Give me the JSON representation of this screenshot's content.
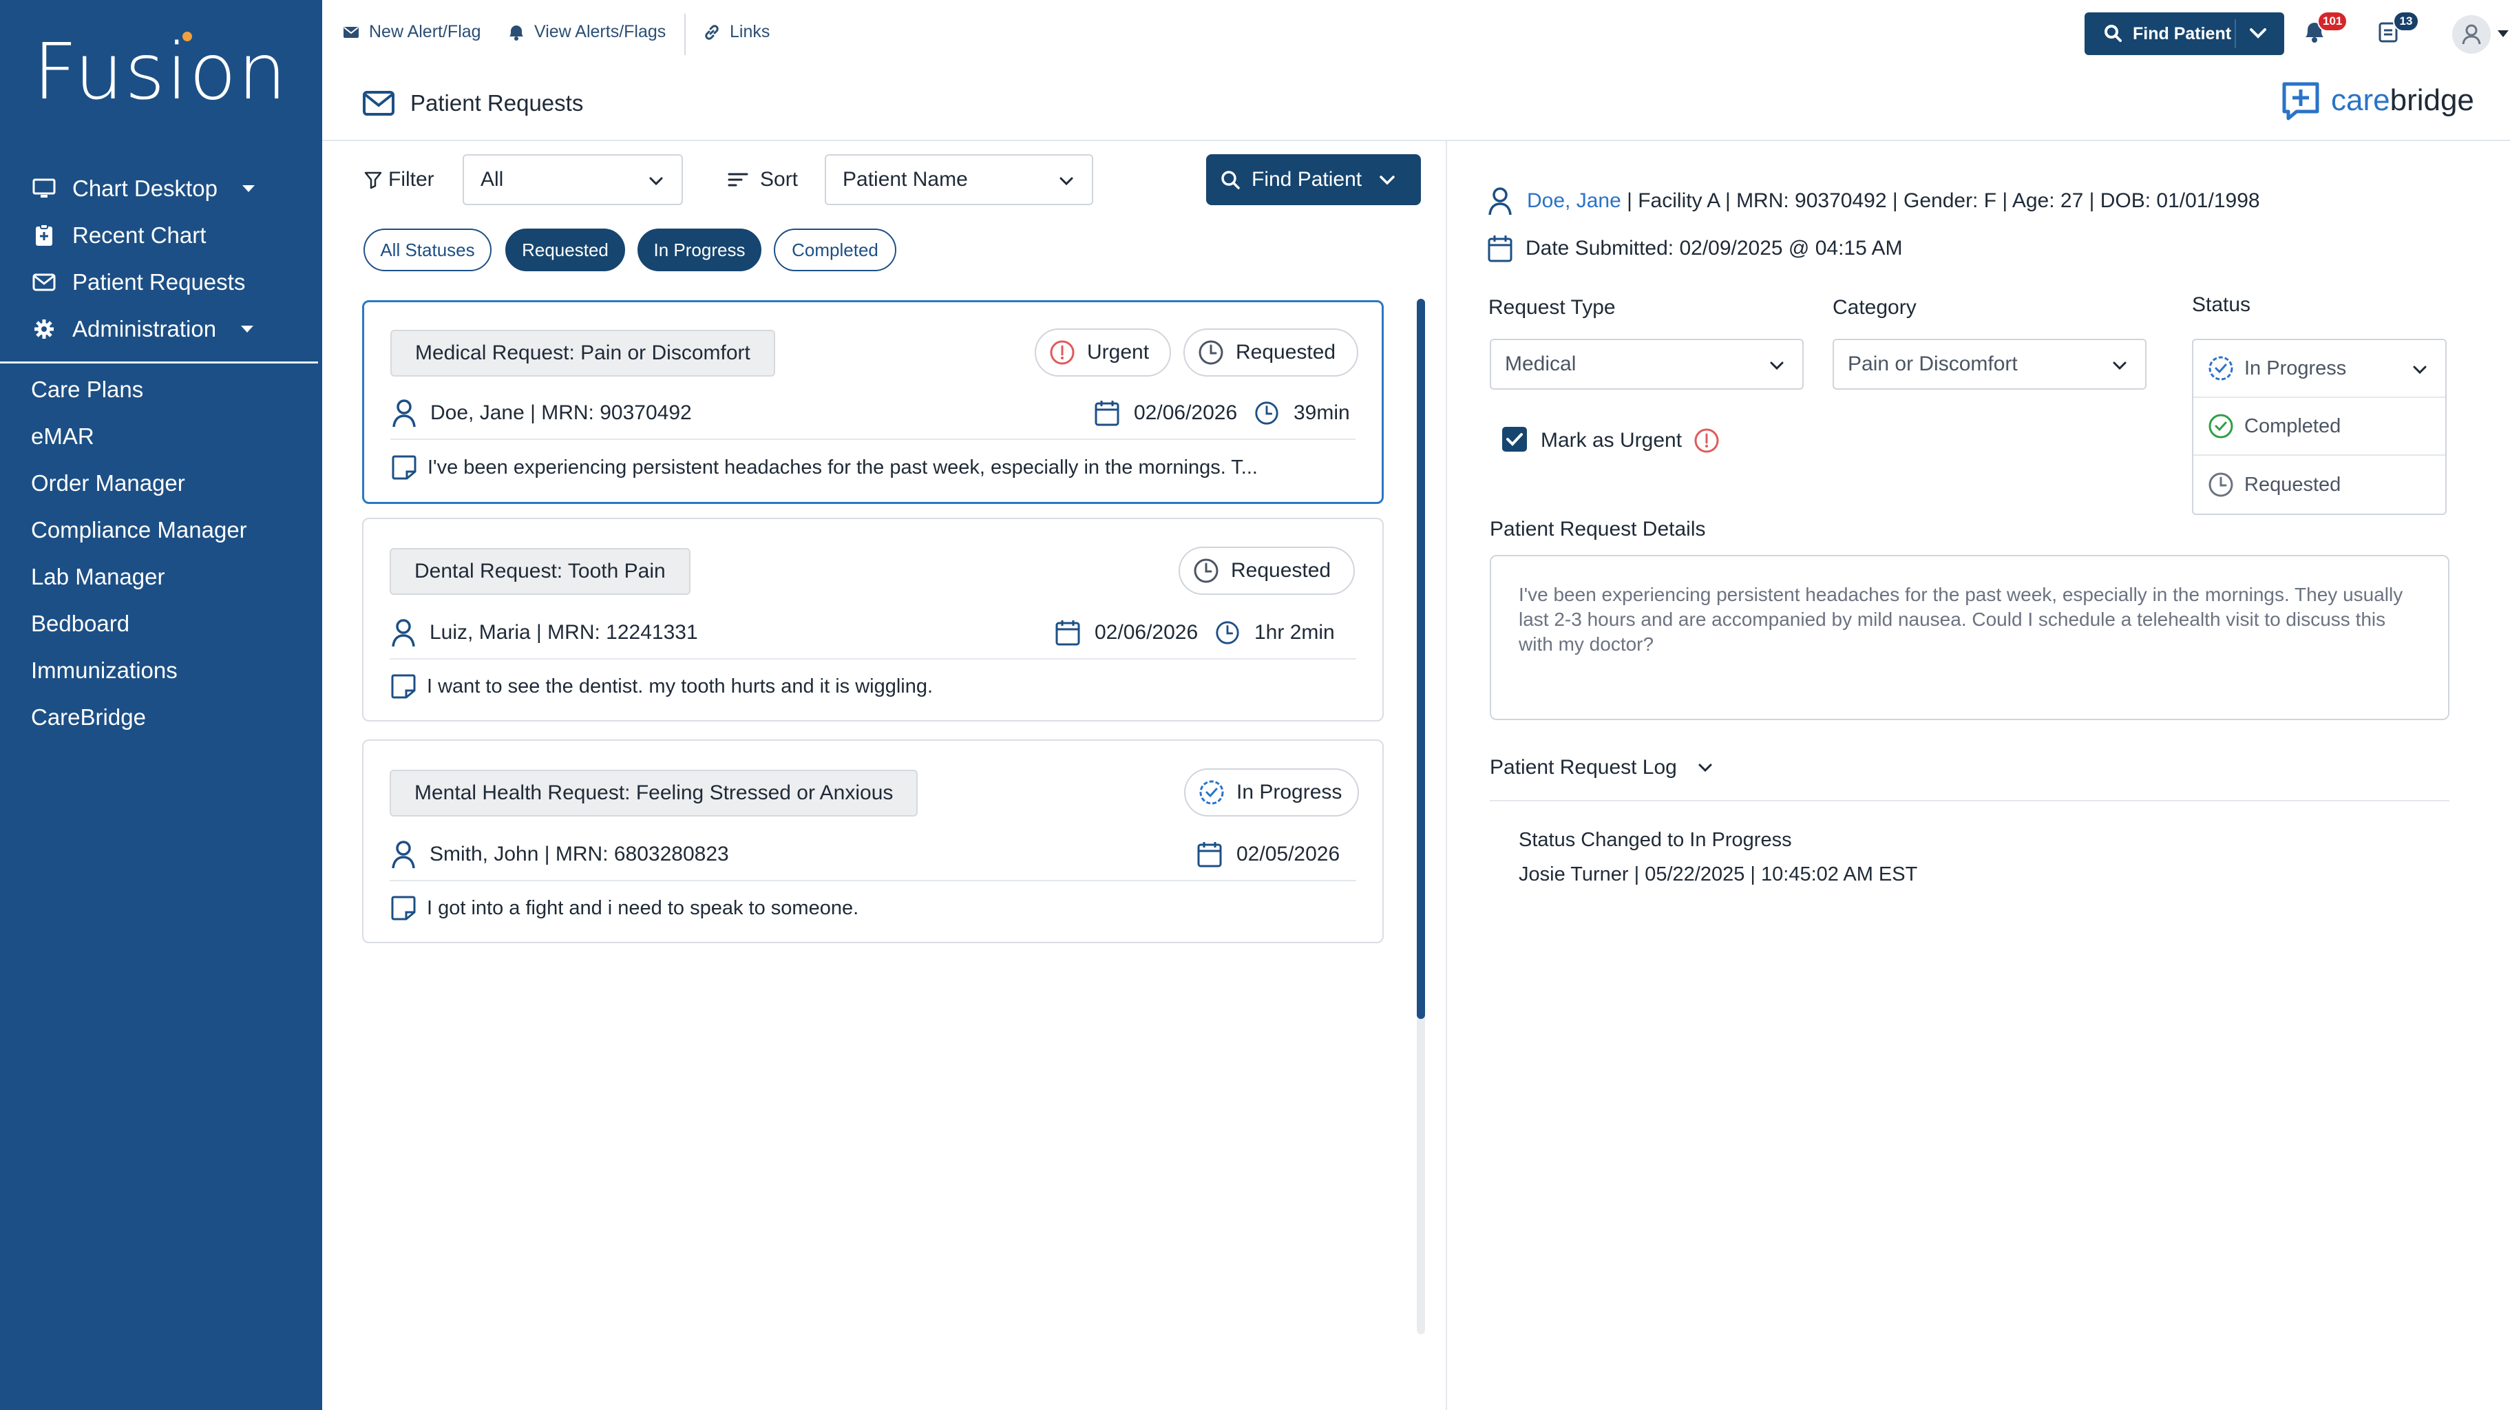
{
  "app": {
    "logo_text": "Fusion"
  },
  "sidebar": {
    "top_items": [
      {
        "label": "Chart Desktop",
        "icon": "monitor-icon",
        "has_caret": true
      },
      {
        "label": "Recent Chart",
        "icon": "clipboard-icon",
        "has_caret": false
      },
      {
        "label": "Patient Requests",
        "icon": "envelope-icon",
        "has_caret": false
      },
      {
        "label": "Administration",
        "icon": "gear-icon",
        "has_caret": true
      }
    ],
    "bottom_items": [
      {
        "label": "Care Plans"
      },
      {
        "label": "eMAR"
      },
      {
        "label": "Order Manager"
      },
      {
        "label": "Compliance Manager"
      },
      {
        "label": "Lab Manager"
      },
      {
        "label": "Bedboard"
      },
      {
        "label": "Immunizations"
      },
      {
        "label": "CareBridge"
      }
    ]
  },
  "toolbar": {
    "new_alert": "New Alert/Flag",
    "view_alerts": "View Alerts/Flags",
    "links": "Links",
    "find_patient": "Find Patient",
    "alerts_count": "101",
    "tasks_count": "13"
  },
  "header": {
    "title": "Patient Requests",
    "brand_care": "care",
    "brand_bridge": "bridge"
  },
  "filters": {
    "filter_label": "Filter",
    "filter_value": "All",
    "sort_label": "Sort",
    "sort_value": "Patient Name",
    "find_patient": "Find Patient",
    "chips": [
      {
        "label": "All Statuses",
        "active": false
      },
      {
        "label": "Requested",
        "active": true
      },
      {
        "label": "In Progress",
        "active": true
      },
      {
        "label": "Completed",
        "active": false
      }
    ]
  },
  "requests": [
    {
      "title": "Medical Request: Pain or Discomfort",
      "urgent_label": "Urgent",
      "status": "Requested",
      "patient": "Doe, Jane | MRN: 90370492",
      "date": "02/06/2026",
      "elapsed": "39min",
      "message": "I've been experiencing persistent headaches for the past week, especially in the mornings. T..."
    },
    {
      "title": "Dental Request: Tooth Pain",
      "status": "Requested",
      "patient": "Luiz, Maria | MRN: 12241331",
      "date": "02/06/2026",
      "elapsed": "1hr 2min",
      "message": "I want to see the dentist. my tooth hurts and it is wiggling."
    },
    {
      "title": "Mental Health Request: Feeling Stressed or Anxious",
      "status": "In Progress",
      "patient": "Smith, John | MRN: 6803280823",
      "date": "02/05/2026",
      "message": "I got into a fight and i need to speak to someone."
    }
  ],
  "detail": {
    "patient_name": "Doe, Jane",
    "patient_meta": " | Facility A | MRN: 90370492 | Gender: F | Age: 27 | DOB: 01/01/1998",
    "date_submitted": "Date Submitted: 02/09/2025 @ 04:15 AM",
    "request_type_label": "Request Type",
    "request_type_value": "Medical",
    "category_label": "Category",
    "category_value": "Pain or Discomfort",
    "status_label": "Status",
    "status_options": [
      "In Progress",
      "Completed",
      "Requested"
    ],
    "mark_urgent_label": "Mark as Urgent",
    "details_label": "Patient Request Details",
    "details_text": "I've been experiencing persistent headaches for the past week, especially in the mornings. They usually last 2-3 hours and are accompanied by mild nausea. Could I schedule a telehealth visit to discuss this with my doctor?",
    "log_label": "Patient Request Log",
    "log_entries": [
      {
        "title": "Status Changed to In Progress",
        "meta": "Josie Turner | 05/22/2025 | 10:45:02 AM EST"
      }
    ]
  },
  "colors": {
    "sidebar_bg": "#1c4f85",
    "primary_button": "#16456f",
    "link_blue": "#2a73c7",
    "urgent_red": "#e05a5a",
    "completed_green": "#2f9e44",
    "badge_red": "#d6262b"
  }
}
